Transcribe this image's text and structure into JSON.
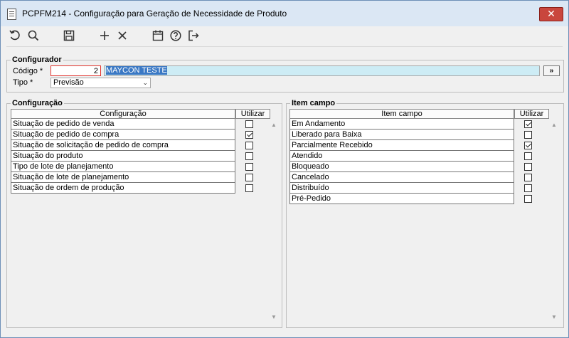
{
  "window": {
    "title": "PCPFM214 - Configuração para Geração de Necessidade de Produto",
    "close_label": "✕"
  },
  "toolbar": {
    "icons": [
      "refresh-icon",
      "search-icon",
      "save-icon",
      "add-icon",
      "delete-icon",
      "calendar-icon",
      "help-icon",
      "exit-icon"
    ]
  },
  "configurador": {
    "legend": "Configurador",
    "codigo_label": "Código *",
    "codigo_value": "2",
    "nome_value": "MAYCON TESTE",
    "lookup_label": "»",
    "tipo_label": "Tipo *",
    "tipo_value": "Previsão"
  },
  "configuracao": {
    "legend": "Configuração",
    "col_main": "Configuração",
    "col_use": "Utilizar",
    "rows": [
      {
        "label": "Situação de pedido de venda",
        "checked": false
      },
      {
        "label": "Situação de pedido de compra",
        "checked": true
      },
      {
        "label": "Situação de solicitação de pedido de compra",
        "checked": false
      },
      {
        "label": "Situação do produto",
        "checked": false
      },
      {
        "label": "Tipo de lote de planejamento",
        "checked": false
      },
      {
        "label": "Situação de lote de planejamento",
        "checked": false
      },
      {
        "label": "Situação de ordem de produção",
        "checked": false
      }
    ]
  },
  "item_campo": {
    "legend": "Item campo",
    "col_main": "Item campo",
    "col_use": "Utilizar",
    "rows": [
      {
        "label": "Em Andamento",
        "checked": true
      },
      {
        "label": "Liberado para Baixa",
        "checked": false
      },
      {
        "label": "Parcialmente Recebido",
        "checked": true
      },
      {
        "label": "Atendido",
        "checked": false
      },
      {
        "label": "Bloqueado",
        "checked": false
      },
      {
        "label": "Cancelado",
        "checked": false
      },
      {
        "label": "Distribuído",
        "checked": false
      },
      {
        "label": "Pré-Pedido",
        "checked": false
      }
    ]
  }
}
